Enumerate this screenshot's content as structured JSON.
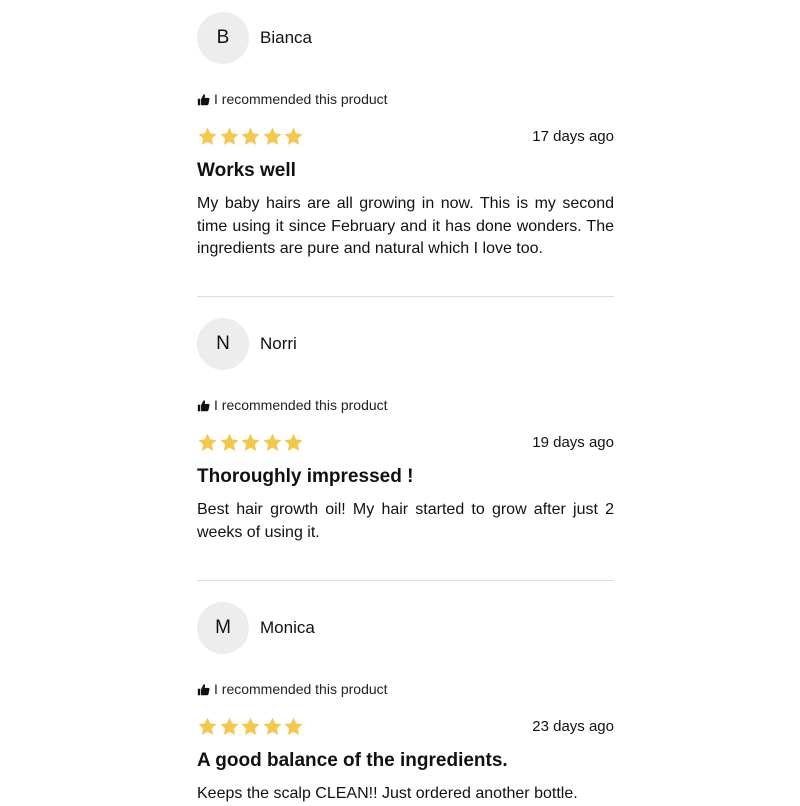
{
  "colors": {
    "star": "#F2C94C",
    "divider": "#DCDCDC",
    "avatar_bg": "#EDEDED"
  },
  "reviews": [
    {
      "initial": "B",
      "name": "Bianca",
      "recommend": "I recommended this product",
      "rating": 5,
      "date": "17 days ago",
      "title": "Works well",
      "body": "My baby hairs are all growing in now. This is my second time using it since February and it has done wonders. The ingredients are pure and natural which I love too."
    },
    {
      "initial": "N",
      "name": "Norri",
      "recommend": "I recommended this product",
      "rating": 5,
      "date": "19 days ago",
      "title": "Thoroughly impressed !",
      "body": "Best hair growth oil! My hair started to grow after just 2 weeks of using it."
    },
    {
      "initial": "M",
      "name": "Monica",
      "recommend": "I recommended this product",
      "rating": 5,
      "date": "23 days ago",
      "title": "A good balance of the ingredients.",
      "body": "Keeps the scalp CLEAN!! Just ordered another bottle."
    }
  ]
}
